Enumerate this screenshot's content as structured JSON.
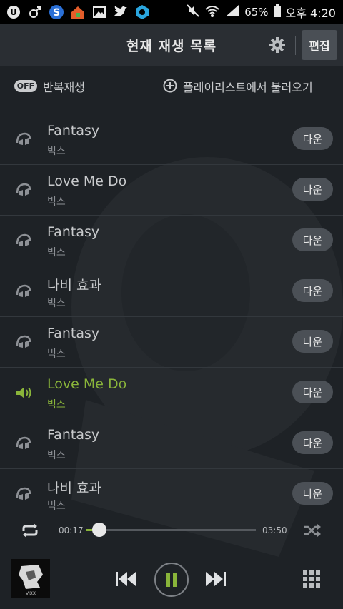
{
  "status_bar": {
    "battery": "65%",
    "time": "오후 4:20",
    "left_icons": [
      "u-plus-icon",
      "gender-icon",
      "s-app-icon",
      "home-app-icon",
      "gallery-icon",
      "twitter-icon",
      "gear-hex-icon"
    ],
    "right_icons": [
      "mute-icon",
      "wifi-icon",
      "signal-icon",
      "battery-icon"
    ]
  },
  "header": {
    "title": "현재 재생 목록",
    "edit_label": "편집"
  },
  "toolbar": {
    "off_badge": "OFF",
    "repeat_label": "반복재생",
    "load_playlist_label": "플레이리스트에서 불러오기"
  },
  "playlist": [
    {
      "song": "Fantasy",
      "artist": "빅스",
      "download": "다운",
      "active": false
    },
    {
      "song": "Love Me Do",
      "artist": "빅스",
      "download": "다운",
      "active": false
    },
    {
      "song": "Fantasy",
      "artist": "빅스",
      "download": "다운",
      "active": false
    },
    {
      "song": "나비 효과",
      "artist": "빅스",
      "download": "다운",
      "active": false
    },
    {
      "song": "Fantasy",
      "artist": "빅스",
      "download": "다운",
      "active": false
    },
    {
      "song": "Love Me Do",
      "artist": "빅스",
      "download": "다운",
      "active": true
    },
    {
      "song": "Fantasy",
      "artist": "빅스",
      "download": "다운",
      "active": false
    },
    {
      "song": "나비 효과",
      "artist": "빅스",
      "download": "다운",
      "active": false
    }
  ],
  "player": {
    "elapsed": "00:17",
    "duration": "03:50",
    "progress": 0.074,
    "album_text": "VIXX"
  },
  "colors": {
    "accent": "#8ab53a",
    "background": "#1e2226",
    "header": "#2a2e33"
  }
}
